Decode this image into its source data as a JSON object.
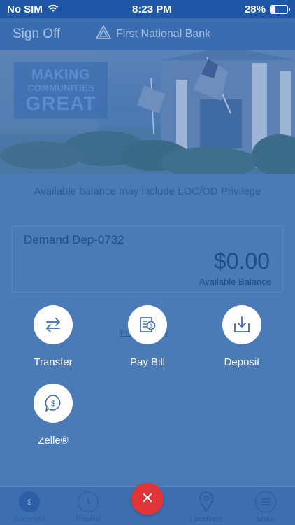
{
  "status_bar": {
    "carrier": "No SIM",
    "time": "8:23 PM",
    "battery": "28%",
    "battery_level": 0.28
  },
  "header": {
    "sign_off": "Sign Off",
    "bank_name": "First National Bank"
  },
  "hero": {
    "badge_line1": "MAKING",
    "badge_line2": "COMMUNITIES",
    "badge_line3": "GREAT"
  },
  "notice": "Available balance may include LOC/OD Privilege",
  "account": {
    "name": "Demand Dep-0732",
    "balance": "$0.00",
    "balance_label": "Available Balance"
  },
  "privacy_link": "Privacy Policy",
  "actions": [
    {
      "label": "Transfer",
      "icon": "transfer-icon"
    },
    {
      "label": "Pay Bill",
      "icon": "bill-icon"
    },
    {
      "label": "Deposit",
      "icon": "deposit-icon"
    },
    {
      "label": "Zelle®",
      "icon": "zelle-icon"
    }
  ],
  "tabs": [
    {
      "label": "Accounts",
      "icon": "accounts-icon",
      "active": true
    },
    {
      "label": "Recent",
      "icon": "clock-icon"
    },
    {
      "label": "Locations",
      "icon": "location-pin-icon"
    },
    {
      "label": "More",
      "icon": "menu-icon"
    }
  ],
  "fab_icon": "close-icon",
  "colors": {
    "primary": "#1f57a6",
    "overlay": "#4a7bb6",
    "fab": "#e03538"
  }
}
